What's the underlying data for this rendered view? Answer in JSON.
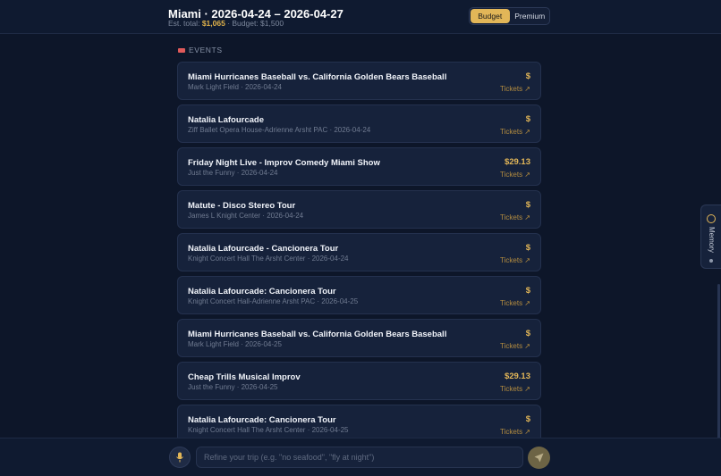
{
  "header": {
    "title": "Miami · 2026-04-24 – 2026-04-27",
    "est_label": "Est. total:",
    "est_total": "$1,065",
    "budget_text": "· Budget: $1,500",
    "toggle": [
      "Budget",
      "Premium"
    ],
    "active_toggle": "Budget"
  },
  "events": {
    "label": "EVENTS",
    "items": [
      {
        "name": "Miami Hurricanes Baseball vs. California Golden Bears Baseball",
        "meta": "Mark Light Field · 2026-04-24",
        "price": "$",
        "tickets": "Tickets ↗"
      },
      {
        "name": "Natalia Lafourcade",
        "meta": "Ziff Ballet Opera House-Adrienne Arsht PAC · 2026-04-24",
        "price": "$",
        "tickets": "Tickets ↗"
      },
      {
        "name": "Friday Night Live - Improv Comedy Miami Show",
        "meta": "Just the Funny · 2026-04-24",
        "price": "$29.13",
        "tickets": "Tickets ↗"
      },
      {
        "name": "Matute - Disco Stereo Tour",
        "meta": "James L Knight Center · 2026-04-24",
        "price": "$",
        "tickets": "Tickets ↗"
      },
      {
        "name": "Natalia Lafourcade - Cancionera Tour",
        "meta": "Knight Concert Hall The Arsht Center · 2026-04-24",
        "price": "$",
        "tickets": "Tickets ↗"
      },
      {
        "name": "Natalia Lafourcade: Cancionera Tour",
        "meta": "Knight Concert Hall-Adrienne Arsht PAC · 2026-04-25",
        "price": "$",
        "tickets": "Tickets ↗"
      },
      {
        "name": "Miami Hurricanes Baseball vs. California Golden Bears Baseball",
        "meta": "Mark Light Field · 2026-04-25",
        "price": "$",
        "tickets": "Tickets ↗"
      },
      {
        "name": "Cheap Trills Musical Improv",
        "meta": "Just the Funny · 2026-04-25",
        "price": "$29.13",
        "tickets": "Tickets ↗"
      },
      {
        "name": "Natalia Lafourcade: Cancionera Tour",
        "meta": "Knight Concert Hall The Arsht Center · 2026-04-25",
        "price": "$",
        "tickets": "Tickets ↗"
      }
    ]
  },
  "memory": {
    "label": "Memory"
  },
  "composer": {
    "placeholder": "Refine your trip (e.g. \"no seafood\", \"fly at night\")"
  },
  "colors": {
    "accent": "#e2b658",
    "background": "#0d1629",
    "card": "#16223b"
  }
}
